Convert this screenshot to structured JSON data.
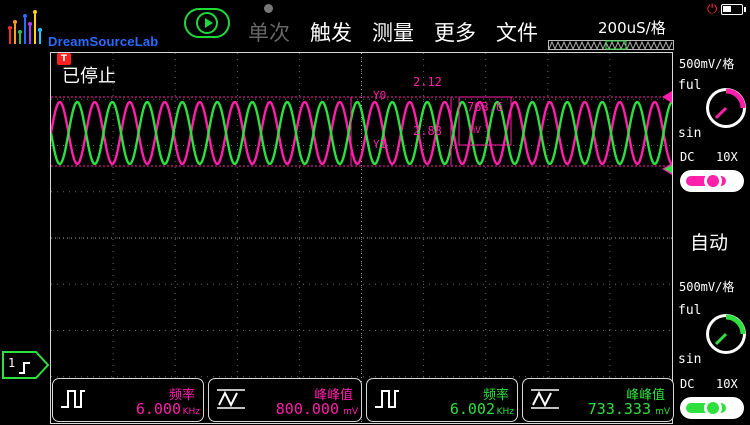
{
  "app": {
    "brand": "DreamSourceLab"
  },
  "toolbar": {
    "single": "单次",
    "trigger": "触发",
    "measure": "测量",
    "more": "更多",
    "file": "文件",
    "timebase": "200uS/格"
  },
  "status": {
    "text": "已停止",
    "trigger_flag": "T"
  },
  "cursor": {
    "y0_label": "Y0",
    "y1_label": "Y1",
    "delta_top": "2.12",
    "delta_value": "763.6",
    "delta_bottom": "2.88",
    "delta_unit": "mV"
  },
  "channels": [
    {
      "name": "1",
      "color": "#ff1faa",
      "scale": "500mV/格",
      "full_label": "ful",
      "sin_label": "sin",
      "coupling": "DC",
      "probe": "10X",
      "freq": "6.000",
      "freq_unit": "KHz",
      "vpp": "800.000",
      "vpp_unit": "mV"
    },
    {
      "name": "2",
      "color": "#2ee03e",
      "scale": "500mV/格",
      "full_label": "ful",
      "sin_label": "sin",
      "coupling": "DC",
      "probe": "10X",
      "freq": "6.002",
      "freq_unit": "KHz",
      "vpp": "733.333",
      "vpp_unit": "mV"
    }
  ],
  "trigger": {
    "mode": "自动"
  },
  "measure_labels": {
    "freq": "频率",
    "vpp": "峰峰值"
  }
}
